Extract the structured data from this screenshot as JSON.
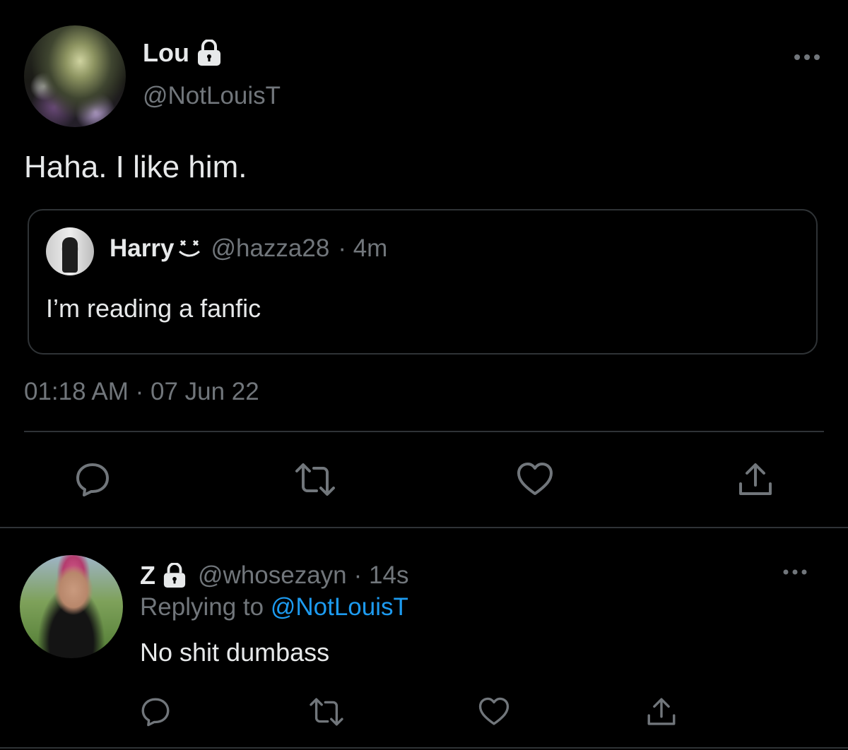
{
  "main_tweet": {
    "author_name": "Lou",
    "author_handle": "@NotLouisT",
    "text": "Haha. I like him.",
    "timestamp": "01:18 AM · 07 Jun 22",
    "quoted": {
      "author_name": "Harry",
      "author_handle": "@hazza28",
      "time": "· 4m",
      "text": "I’m reading a fanfic"
    }
  },
  "reply": {
    "author_name": "Z",
    "author_handle": "@whosezayn",
    "time": "· 14s",
    "replying_label": "Replying to",
    "replying_mention": "@NotLouisT",
    "text": "No shit dumbass"
  },
  "icons": {
    "lock": "lock-icon",
    "emoji": "face-emoji-icon",
    "more": "more-dots-icon",
    "reply": "reply-bubble-icon",
    "retweet": "retweet-icon",
    "like": "heart-icon",
    "share": "share-icon"
  },
  "colors": {
    "background": "#000000",
    "text": "#e7e9ea",
    "secondary": "#71767b",
    "link": "#1d9bf0",
    "border": "#2f3336"
  }
}
